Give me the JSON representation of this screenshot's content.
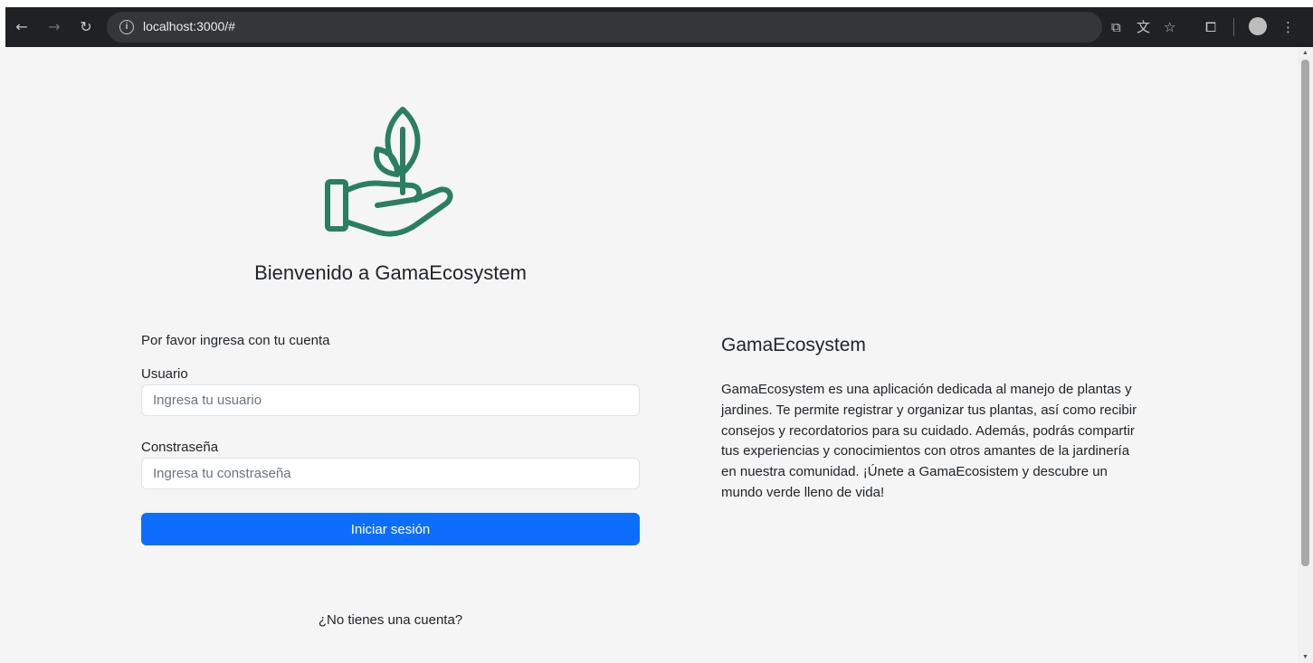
{
  "browser": {
    "url": "localhost:3000/#",
    "icons": {
      "back": "arrow-left-icon",
      "forward": "arrow-right-icon",
      "reload": "reload-icon",
      "site_info": "info-icon",
      "cast": "cast-icon",
      "translate": "translate-icon",
      "bookmark": "star-icon",
      "extensions": "puzzle-icon",
      "profile": "avatar",
      "menu": "kebab-menu-icon"
    }
  },
  "login": {
    "welcome": "Bienvenido a GamaEcosystem",
    "prompt": "Por favor ingresa con tu cuenta",
    "username_label": "Usuario",
    "username_placeholder": "Ingresa tu usuario",
    "password_label": "Constraseña",
    "password_placeholder": "Ingresa tu constraseña",
    "submit_label": "Iniciar sesión",
    "signup_text": "¿No tienes una cuenta?"
  },
  "about": {
    "title": "GamaEcosystem",
    "description": "GamaEcosystem es una aplicación dedicada al manejo de plantas y jardines. Te permite registrar y organizar tus plantas, así como recibir consejos y recordatorios para su cuidado. Además, podrás compartir tus experiencias y conocimientos con otros amantes de la jardinería en nuestra comunidad. ¡Únete a GamaEcosistem y descubre un mundo verde lleno de vida!"
  },
  "colors": {
    "brand_green": "#2a7f62",
    "primary_button": "#0d6efd",
    "page_background": "#f5f5f5"
  }
}
